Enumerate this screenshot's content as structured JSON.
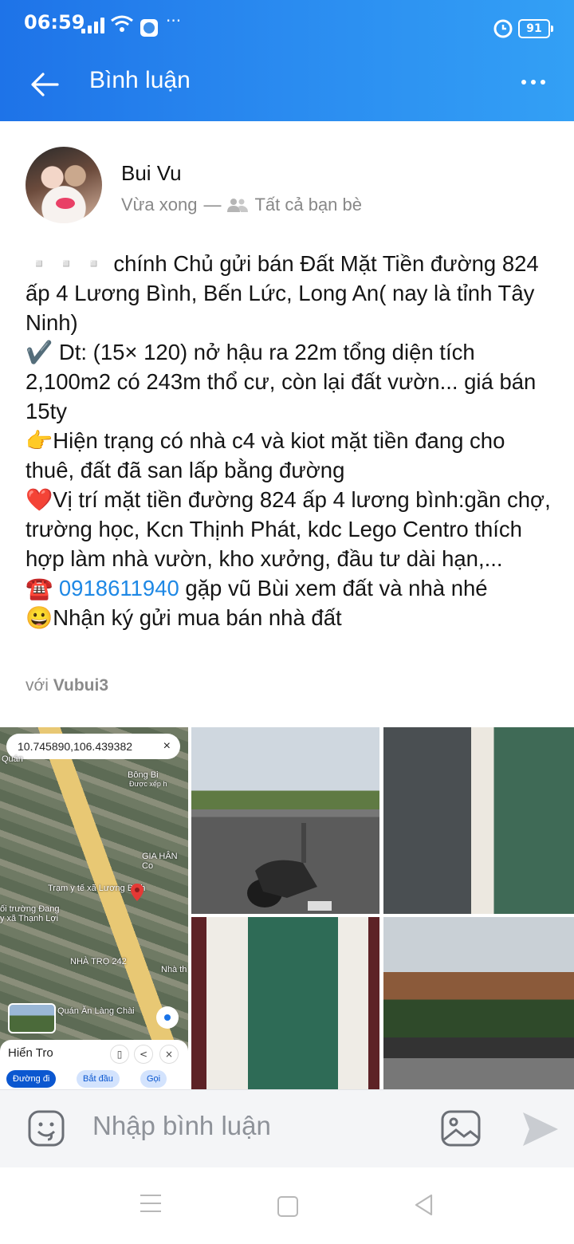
{
  "status": {
    "time": "06:59",
    "battery": "91",
    "more": "···"
  },
  "header": {
    "title": "Bình luận"
  },
  "post": {
    "author": "Bui Vu",
    "time": "Vừa xong",
    "separator": "—",
    "audience": "Tất cả bạn bè",
    "lines": [
      "▫️▫️▫️ chính Chủ gửi bán Đất Mặt Tiền đường 824 ấp 4 Lương Bình, Bến Lức, Long An( nay là tỉnh Tây Ninh)",
      "✔️ Dt: (15× 120) nở hậu ra 22m tổng diện tích 2,100m2 có 243m thổ cư, còn lại đất vườn... giá bán 15ty",
      "👉Hiện trạng có nhà c4 và kiot mặt tiền đang cho thuê, đất đã san lấp bằng đường",
      "❤️Vị trí mặt tiền đường 824 ấp 4 lương bình:gần chợ, trường học, Kcn Thịnh Phát, kdc Lego Centro thích hợp làm nhà vườn, kho xưởng, đầu tư dài hạn,..."
    ],
    "phone_prefix": "☎️ ",
    "phone": "0918611940",
    "phone_suffix": " gặp vũ Bùi xem đất và nhà nhé",
    "last_line": "😀Nhận ký gửi mua bán nhà đất",
    "with_label": "với",
    "with_name": "Vubui3"
  },
  "map": {
    "coords": "10.745890,106.439382",
    "close": "×",
    "labels": [
      "Quán",
      "Bông Bi",
      "Được xếp h",
      "GIA HÂN Co",
      "Trạm y tế xã Lương Bình",
      "ối trường Đang",
      "y xã Thạnh Lợi",
      "NHÀ TRỌ 242",
      "Nhà th",
      "Quán Ăn Làng Chài"
    ],
    "place_name": "Hiển Tro",
    "buttons": [
      "Đường đi",
      "Bắt đầu",
      "Gọi"
    ]
  },
  "comment": {
    "placeholder": "Nhập bình luận"
  },
  "icons": {
    "back": "arrow-left-icon",
    "more": "more-horizontal-icon",
    "emoji": "emoji-icon",
    "image": "image-icon",
    "send": "send-icon"
  },
  "colors": {
    "header_start": "#1e73e8",
    "header_end": "#33a0f5",
    "link": "#1e88e5"
  }
}
